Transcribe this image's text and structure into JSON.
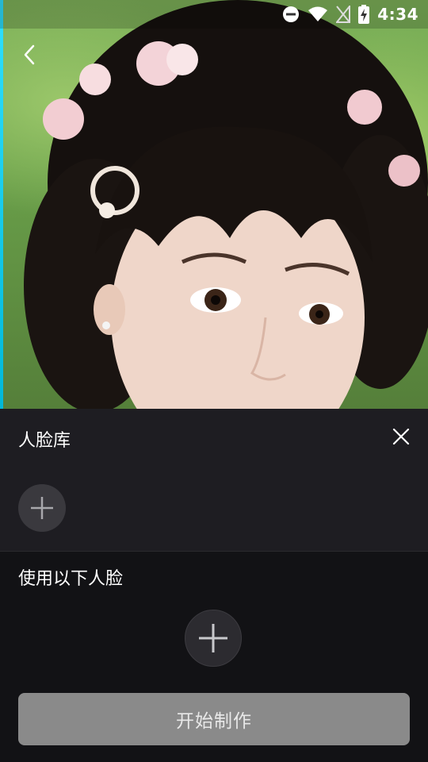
{
  "status_bar": {
    "time": "4:34",
    "icons": [
      "do-not-disturb-icon",
      "wifi-icon",
      "no-sim-icon",
      "battery-charging-icon"
    ]
  },
  "photo": {
    "description_icon": "portrait-photo"
  },
  "face_library": {
    "title": "人脸库",
    "close_icon": "close-icon",
    "add_icon": "plus-icon"
  },
  "use_faces": {
    "title": "使用以下人脸",
    "add_icon": "plus-icon"
  },
  "start_button": {
    "label": "开始制作"
  },
  "colors": {
    "panel_bg": "#1e1d22",
    "page_bg": "#121215",
    "button_bg": "#8a8a8a",
    "add_circle": "#3a393e"
  }
}
